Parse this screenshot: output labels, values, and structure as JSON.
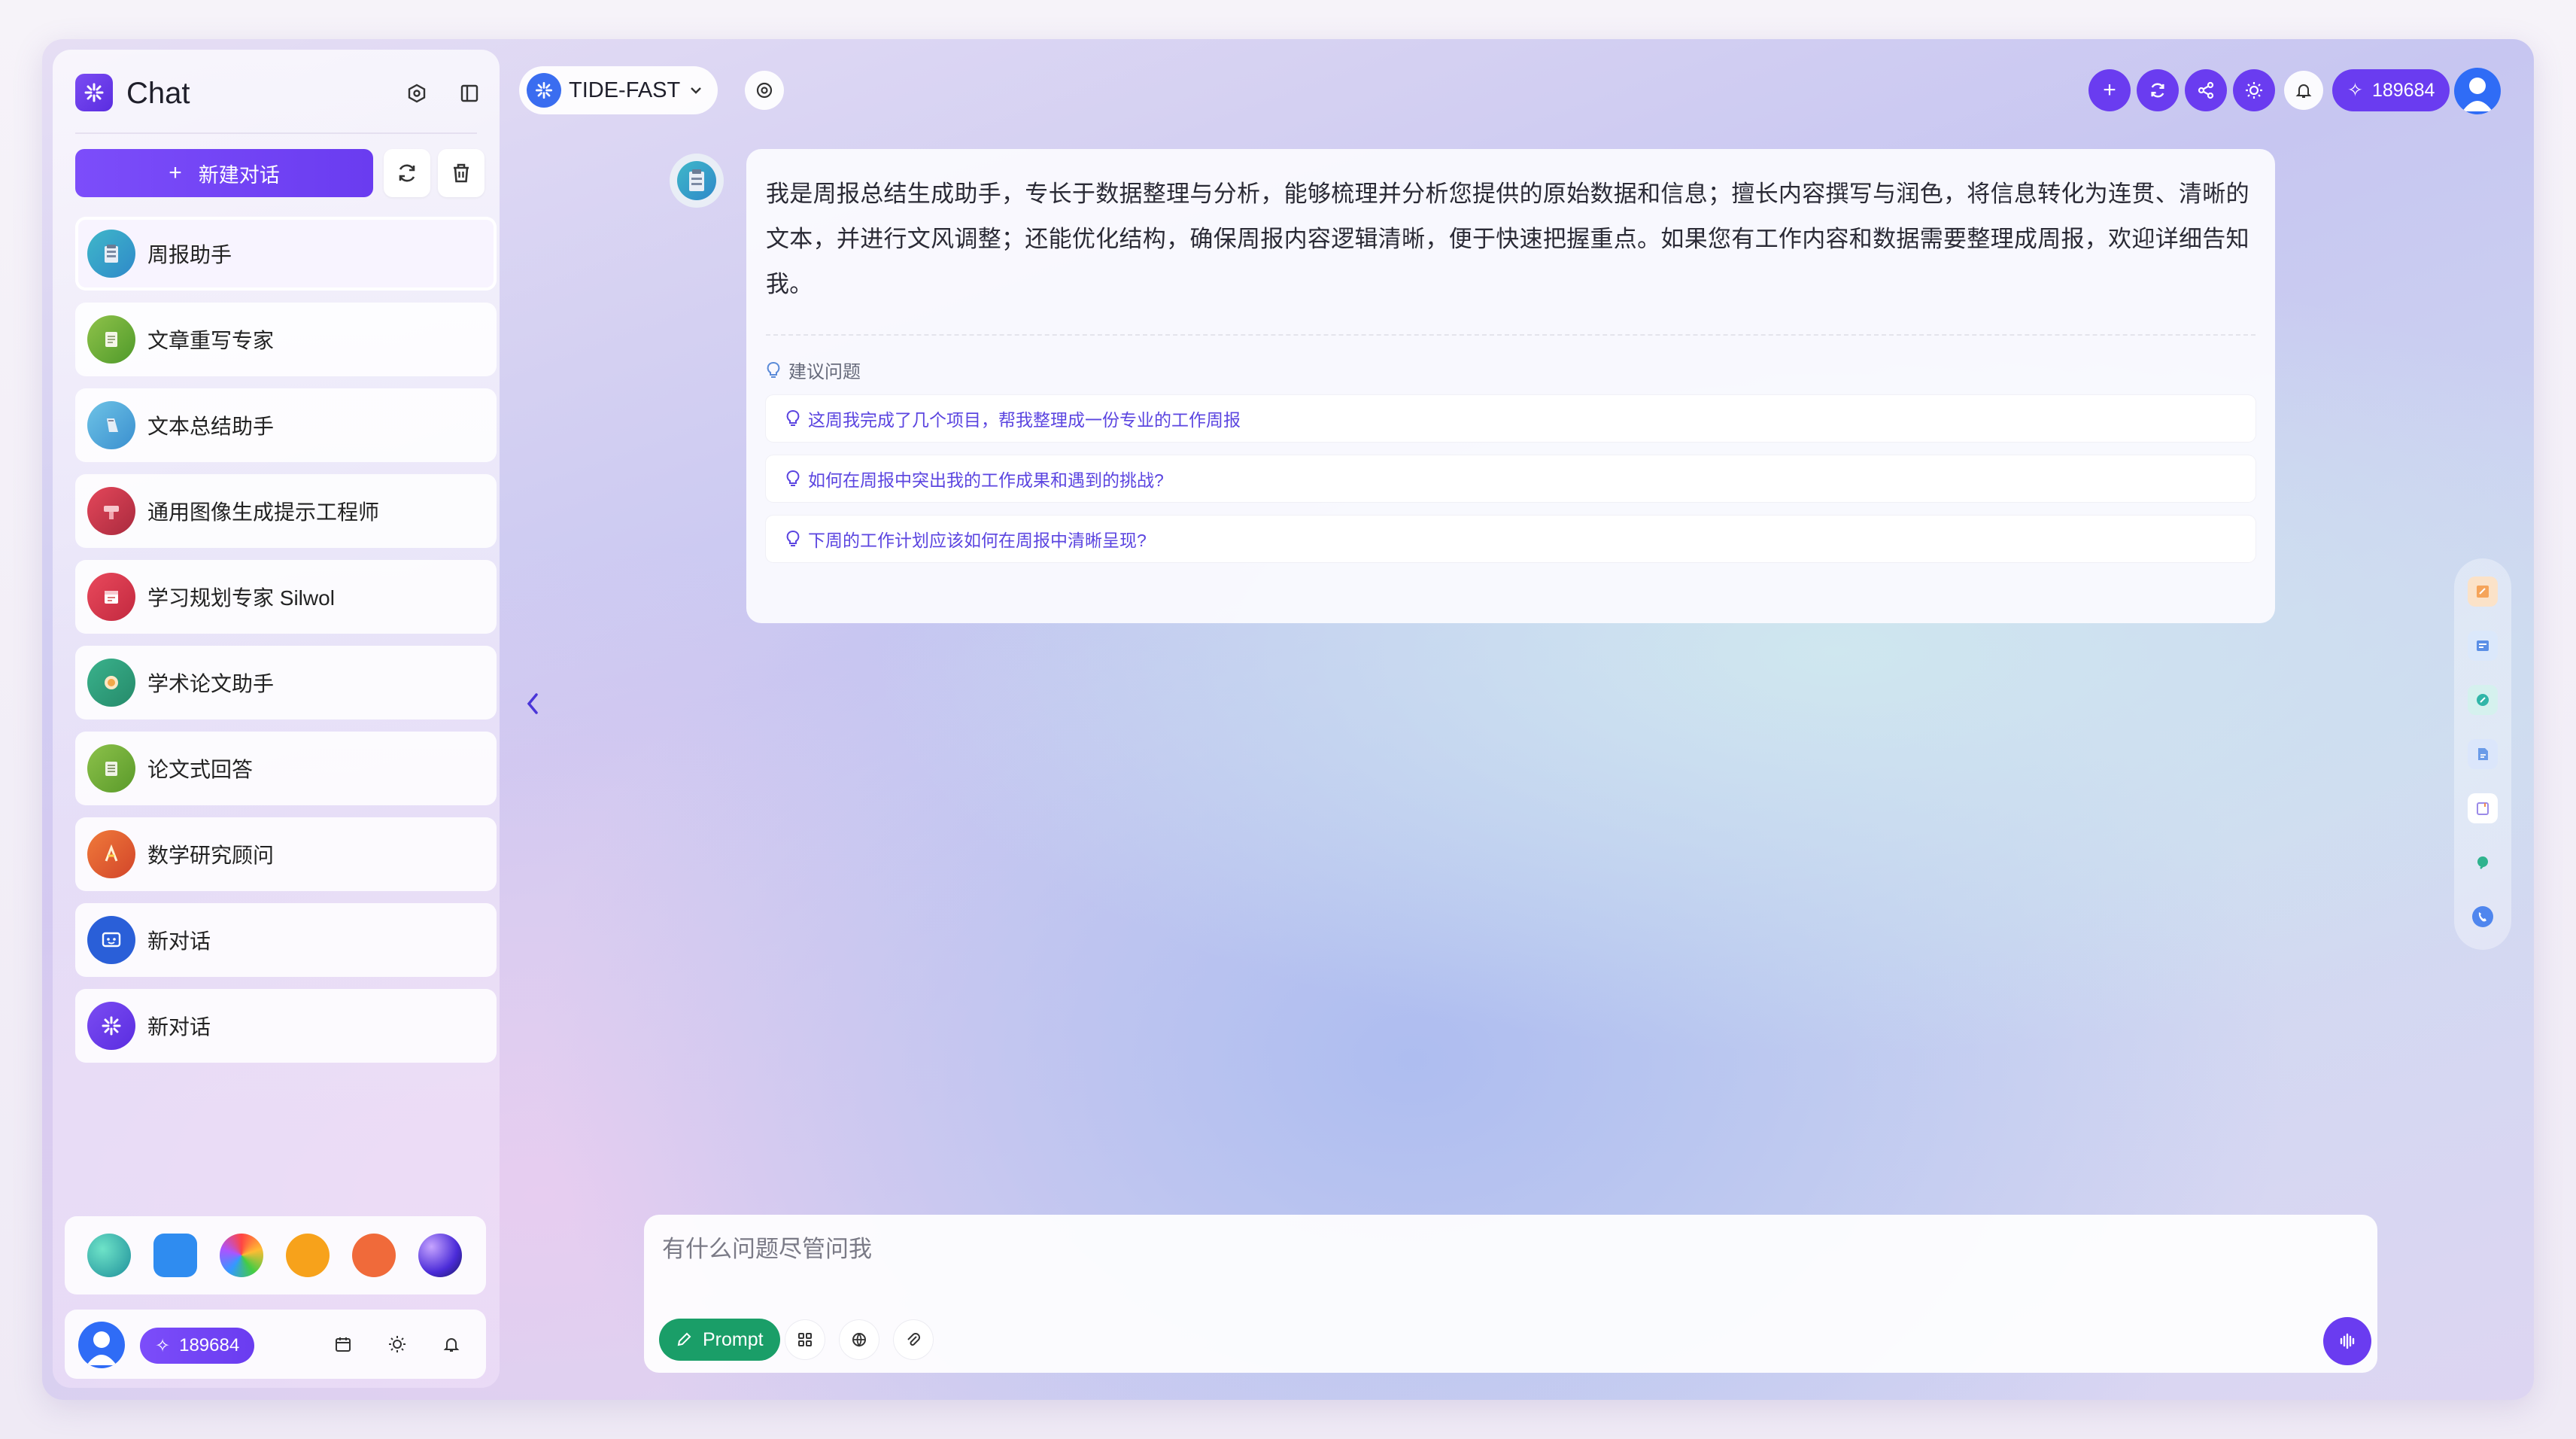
{
  "app": {
    "title": "Chat"
  },
  "sidebar": {
    "new_chat_label": "新建对话",
    "conversations": [
      {
        "label": "周报助手",
        "icon": "weekly-report-avatar-icon",
        "active": true
      },
      {
        "label": "文章重写专家",
        "icon": "article-rewrite-avatar-icon"
      },
      {
        "label": "文本总结助手",
        "icon": "text-summary-avatar-icon"
      },
      {
        "label": "通用图像生成提示工程师",
        "icon": "image-prompt-avatar-icon"
      },
      {
        "label": "学习规划专家 Silwol",
        "icon": "study-plan-avatar-icon"
      },
      {
        "label": "学术论文助手",
        "icon": "academic-paper-avatar-icon"
      },
      {
        "label": "论文式回答",
        "icon": "essay-answer-avatar-icon"
      },
      {
        "label": "数学研究顾问",
        "icon": "math-advisor-avatar-icon"
      },
      {
        "label": "新对话",
        "icon": "chat-robot-avatar-icon"
      },
      {
        "label": "新对话",
        "icon": "app-logo-avatar-icon"
      }
    ],
    "apps": [
      "planet-app-icon",
      "robot-app-icon",
      "flower-app-icon",
      "play-app-icon",
      "ppt-app-icon",
      "orb-app-icon"
    ],
    "user": {
      "points": "189684"
    }
  },
  "topbar": {
    "model": "TIDE-FAST",
    "points": "189684"
  },
  "message": {
    "text": "我是周报总结生成助手，专长于数据整理与分析，能够梳理并分析您提供的原始数据和信息；擅长内容撰写与润色，将信息转化为连贯、清晰的文本，并进行文风调整；还能优化结构，确保周报内容逻辑清晰，便于快速把握重点。如果您有工作内容和数据需要整理成周报，欢迎详细告知我。",
    "suggest_title": "建议问题",
    "suggestions": [
      "这周我完成了几个项目，帮我整理成一份专业的工作周报",
      "如何在周报中突出我的工作成果和遇到的挑战?",
      "下周的工作计划应该如何在周报中清晰呈现?"
    ]
  },
  "input": {
    "placeholder": "有什么问题尽管问我",
    "value": "",
    "prompt_label": "Prompt"
  },
  "colors": {
    "accent": "#6a3cf0",
    "prompt_green": "#1a9e68",
    "link": "#5b45e0"
  }
}
